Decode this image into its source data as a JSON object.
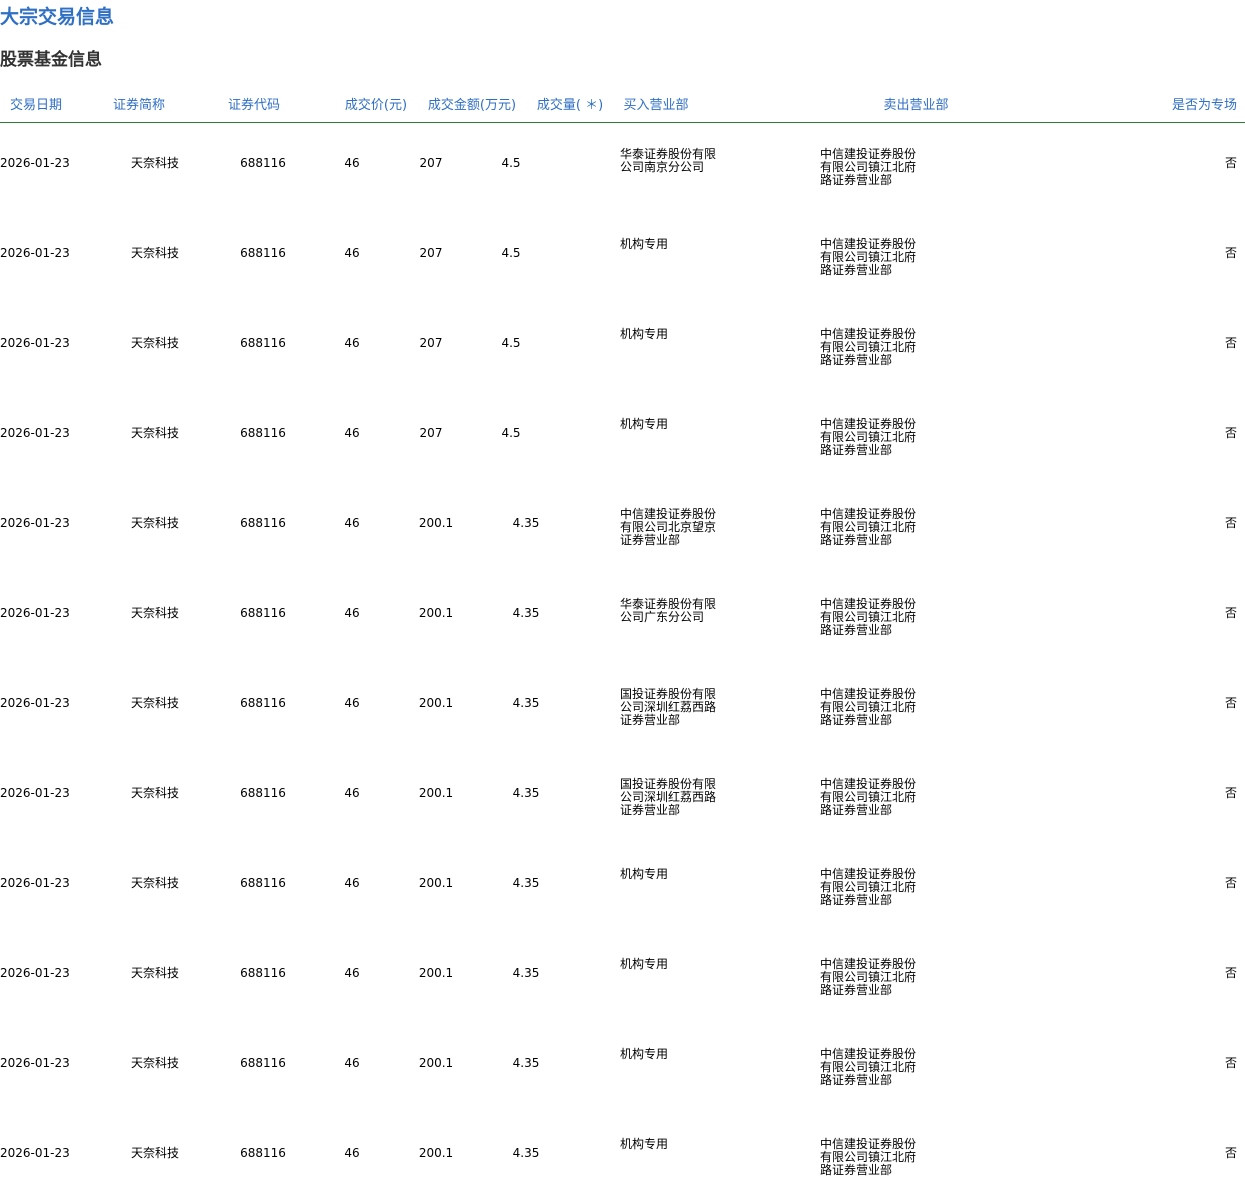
{
  "page": {
    "title": "大宗交易信息",
    "section_title": "股票基金信息"
  },
  "table": {
    "headers": {
      "date": "交易日期",
      "name": "证券简称",
      "code": "证券代码",
      "price": "成交价(元)",
      "amount": "成交金额(万元)",
      "volume": "成交量( ＊)",
      "buyer": "买入营业部",
      "seller": "卖出营业部",
      "special": "是否为专场"
    },
    "rows": [
      {
        "date": "2026-01-23",
        "name": "天奈科技",
        "code": "688116",
        "price": "46",
        "amount": "207",
        "volume": "4.5",
        "buyer": "华泰证券股份有限公司南京分公司",
        "seller": "中信建投证券股份有限公司镇江北府路证券营业部",
        "special": "否"
      },
      {
        "date": "2026-01-23",
        "name": "天奈科技",
        "code": "688116",
        "price": "46",
        "amount": "207",
        "volume": "4.5",
        "buyer": "机构专用",
        "seller": "中信建投证券股份有限公司镇江北府路证券营业部",
        "special": "否"
      },
      {
        "date": "2026-01-23",
        "name": "天奈科技",
        "code": "688116",
        "price": "46",
        "amount": "207",
        "volume": "4.5",
        "buyer": "机构专用",
        "seller": "中信建投证券股份有限公司镇江北府路证券营业部",
        "special": "否"
      },
      {
        "date": "2026-01-23",
        "name": "天奈科技",
        "code": "688116",
        "price": "46",
        "amount": "207",
        "volume": "4.5",
        "buyer": "机构专用",
        "seller": "中信建投证券股份有限公司镇江北府路证券营业部",
        "special": "否"
      },
      {
        "date": "2026-01-23",
        "name": "天奈科技",
        "code": "688116",
        "price": "46",
        "amount": "200.1",
        "volume": "4.35",
        "buyer": "中信建投证券股份有限公司北京望京证券营业部",
        "seller": "中信建投证券股份有限公司镇江北府路证券营业部",
        "special": "否"
      },
      {
        "date": "2026-01-23",
        "name": "天奈科技",
        "code": "688116",
        "price": "46",
        "amount": "200.1",
        "volume": "4.35",
        "buyer": "华泰证券股份有限公司广东分公司",
        "seller": "中信建投证券股份有限公司镇江北府路证券营业部",
        "special": "否"
      },
      {
        "date": "2026-01-23",
        "name": "天奈科技",
        "code": "688116",
        "price": "46",
        "amount": "200.1",
        "volume": "4.35",
        "buyer": "国投证券股份有限公司深圳红荔西路证券营业部",
        "seller": "中信建投证券股份有限公司镇江北府路证券营业部",
        "special": "否"
      },
      {
        "date": "2026-01-23",
        "name": "天奈科技",
        "code": "688116",
        "price": "46",
        "amount": "200.1",
        "volume": "4.35",
        "buyer": "国投证券股份有限公司深圳红荔西路证券营业部",
        "seller": "中信建投证券股份有限公司镇江北府路证券营业部",
        "special": "否"
      },
      {
        "date": "2026-01-23",
        "name": "天奈科技",
        "code": "688116",
        "price": "46",
        "amount": "200.1",
        "volume": "4.35",
        "buyer": "机构专用",
        "seller": "中信建投证券股份有限公司镇江北府路证券营业部",
        "special": "否"
      },
      {
        "date": "2026-01-23",
        "name": "天奈科技",
        "code": "688116",
        "price": "46",
        "amount": "200.1",
        "volume": "4.35",
        "buyer": "机构专用",
        "seller": "中信建投证券股份有限公司镇江北府路证券营业部",
        "special": "否"
      },
      {
        "date": "2026-01-23",
        "name": "天奈科技",
        "code": "688116",
        "price": "46",
        "amount": "200.1",
        "volume": "4.35",
        "buyer": "机构专用",
        "seller": "中信建投证券股份有限公司镇江北府路证券营业部",
        "special": "否"
      },
      {
        "date": "2026-01-23",
        "name": "天奈科技",
        "code": "688116",
        "price": "46",
        "amount": "200.1",
        "volume": "4.35",
        "buyer": "机构专用",
        "seller": "中信建投证券股份有限公司镇江北府路证券营业部",
        "special": "否"
      }
    ]
  }
}
